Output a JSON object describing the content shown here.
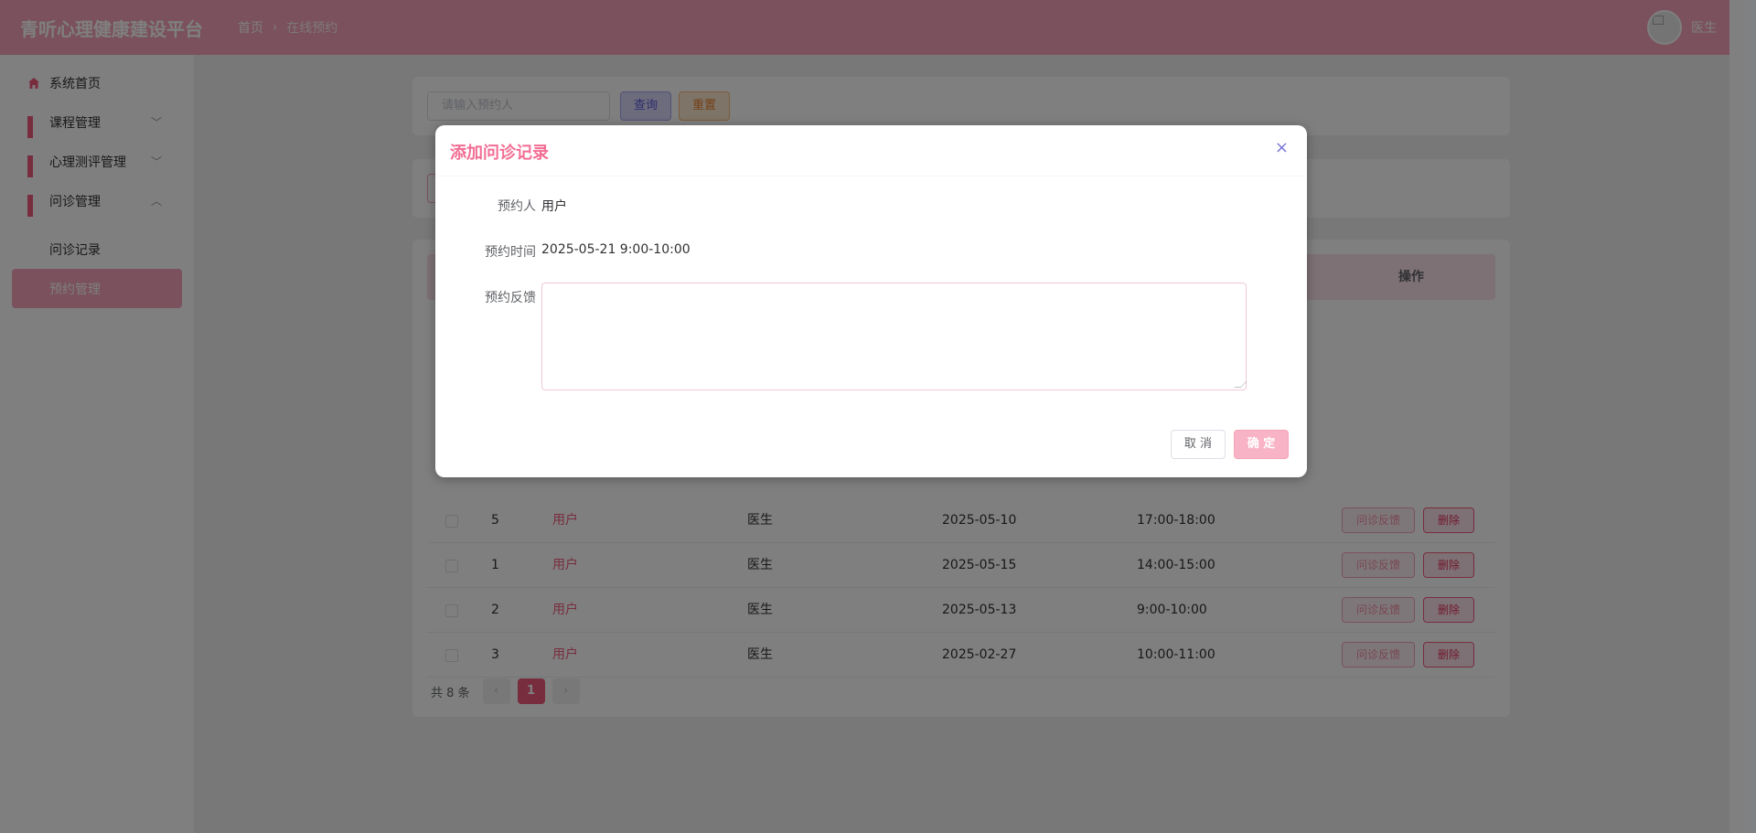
{
  "app": {
    "title": "青听心理健康建设平台"
  },
  "breadcrumb": {
    "home": "首页",
    "current": "在线预约"
  },
  "user": {
    "name": "医生"
  },
  "sidebar": {
    "items": [
      {
        "label": "系统首页",
        "icon": "home-icon"
      },
      {
        "label": "课程管理",
        "icon": "grid-icon"
      },
      {
        "label": "心理测评管理",
        "icon": "grid-icon"
      },
      {
        "label": "问诊管理",
        "icon": "grid-icon"
      }
    ],
    "sub_items": [
      {
        "label": "问诊记录"
      },
      {
        "label": "预约管理"
      }
    ]
  },
  "search": {
    "placeholder": "请输入预约人",
    "query_label": "查询",
    "reset_label": "重置"
  },
  "table": {
    "action_header": "操作",
    "feedback_label": "问诊反馈",
    "delete_label": "删除",
    "rows": [
      {
        "id": "5",
        "user": "用户",
        "doctor": "医生",
        "date": "2025-05-10",
        "time": "17:00-18:00"
      },
      {
        "id": "1",
        "user": "用户",
        "doctor": "医生",
        "date": "2025-05-15",
        "time": "14:00-15:00"
      },
      {
        "id": "2",
        "user": "用户",
        "doctor": "医生",
        "date": "2025-05-13",
        "time": "9:00-10:00"
      },
      {
        "id": "3",
        "user": "用户",
        "doctor": "医生",
        "date": "2025-02-27",
        "time": "10:00-11:00"
      }
    ]
  },
  "pagination": {
    "total": "共 8 条",
    "prev": "‹",
    "page": "1",
    "next": "›"
  },
  "dialog": {
    "title": "添加问诊记录",
    "close": "×",
    "fields": {
      "person_label": "预约人",
      "person_value": "用户",
      "time_label": "预约时间",
      "time_value": "2025-05-21 9:00-10:00",
      "feedback_label": "预约反馈",
      "feedback_value": ""
    },
    "cancel_label": "取 消",
    "ok_label": "确 定"
  },
  "colors": {
    "primary": "#f05a7e",
    "header": "#f5a3b8",
    "accent": "#f26d94"
  }
}
